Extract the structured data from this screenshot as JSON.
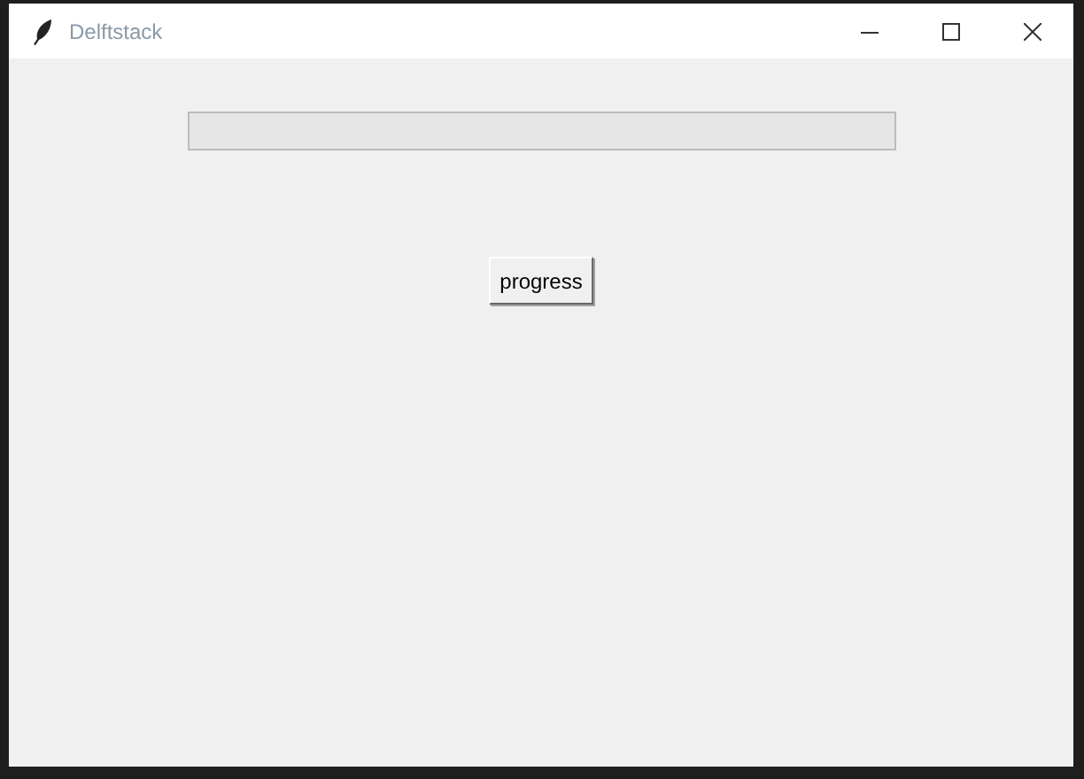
{
  "window": {
    "title": "Delftstack"
  },
  "progress_bar": {
    "level": 0
  },
  "button": {
    "label": "progress"
  }
}
